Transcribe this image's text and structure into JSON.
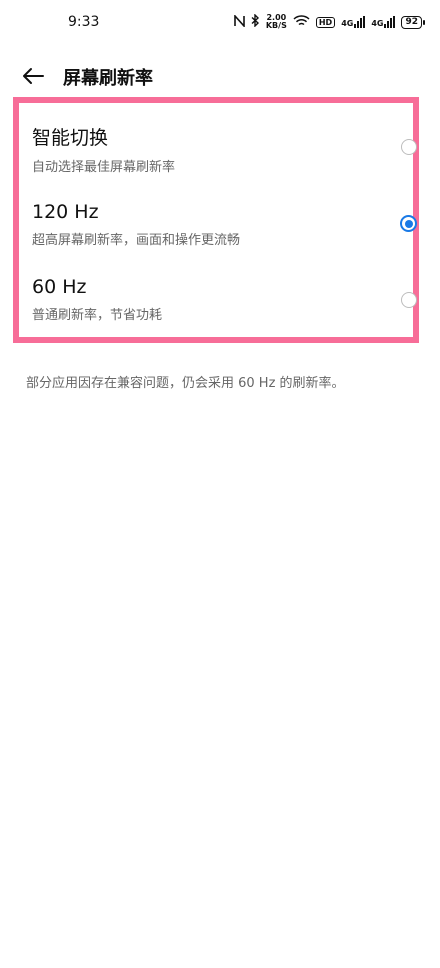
{
  "status_bar": {
    "time": "9:33",
    "speed_value": "2.00",
    "speed_unit": "KB/S",
    "hd_label": "HD",
    "net1": "4G",
    "net2": "4G",
    "battery": "92"
  },
  "header": {
    "title": "屏幕刷新率"
  },
  "options": [
    {
      "title": "智能切换",
      "description": "自动选择最佳屏幕刷新率",
      "selected": false
    },
    {
      "title": "120 Hz",
      "description": "超高屏幕刷新率，画面和操作更流畅",
      "selected": true
    },
    {
      "title": "60 Hz",
      "description": "普通刷新率，节省功耗",
      "selected": false
    }
  ],
  "footnote": "部分应用因存在兼容问题，仍会采用 60 Hz 的刷新率。",
  "colors": {
    "accent": "#1a7ae6",
    "highlight_border": "#f76d98"
  }
}
